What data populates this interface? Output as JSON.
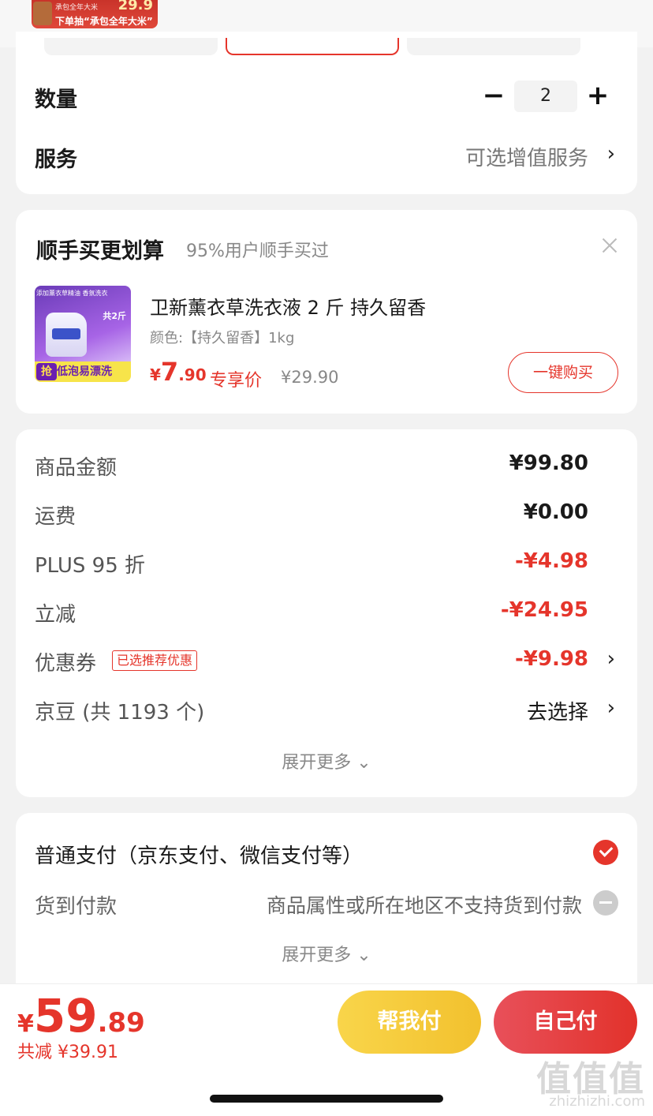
{
  "promo_banner": {
    "small_text": "承包全年大米",
    "price": "29.9",
    "main_text": "下单抽“承包全年大米”"
  },
  "quantity": {
    "label": "数量",
    "value": "2",
    "minus": "−",
    "plus": "+"
  },
  "service": {
    "label": "服务",
    "value": "可选增值服务",
    "chevron": "›"
  },
  "bundle": {
    "title": "顺手买更划算",
    "subtitle": "95%用户顺手买过",
    "product_image": {
      "top_text": "添加薰衣草精油 香氛洗衣",
      "tag": "共2斤",
      "badge": "抢",
      "banner": "低泡易漂洗"
    },
    "product_name": "卫新薰衣草洗衣液 2 斤 持久留香",
    "product_spec": "颜色:【持久留香】1kg",
    "price_currency": "¥",
    "price_int": "7",
    "price_dec": ".90",
    "price_tag": "专享价",
    "price_old": "¥29.90",
    "buy_button": "一键购买"
  },
  "breakdown": {
    "rows": [
      {
        "label": "商品金额",
        "value": "¥99.80"
      },
      {
        "label": "运费",
        "value": "¥0.00"
      },
      {
        "label": "PLUS 95 折",
        "value": "-¥4.98"
      },
      {
        "label": "立减",
        "value": "-¥24.95"
      },
      {
        "label": "优惠券",
        "value": "-¥9.98",
        "badge": "已选推荐优惠"
      },
      {
        "label": "京豆 (共 1193 个)",
        "value": "去选择"
      }
    ],
    "expand": "展开更多 ⌄",
    "accent_color": "#e5352b"
  },
  "payment": {
    "normal": "普通支付（京东支付、微信支付等）",
    "cod": "货到付款",
    "cod_note": "商品属性或所在地区不支持货到付款",
    "expand": "展开更多 ⌄",
    "icons": [
      "check-circle-icon",
      "disabled-circle-icon"
    ]
  },
  "footer": {
    "currency": "¥",
    "total_int": "59",
    "total_dec": ".89",
    "saved": "共减 ¥39.91",
    "help_pay": "帮我付",
    "self_pay": "自己付"
  },
  "watermark": {
    "logo": "值值值",
    "url": "zhizhizhi.com"
  }
}
